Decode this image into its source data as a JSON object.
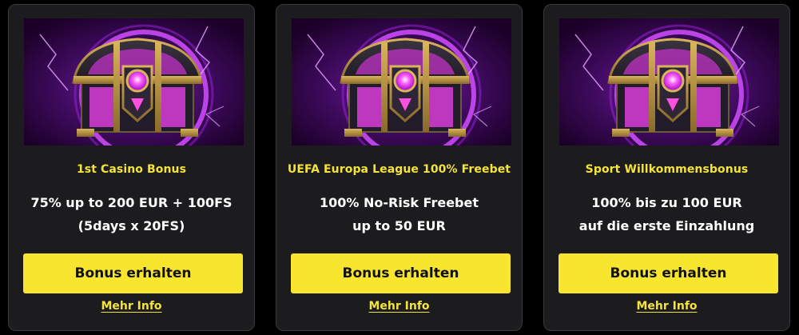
{
  "colors": {
    "page_background": "#000000",
    "card_background": "#1c1c1e",
    "accent_yellow": "#f4e43a",
    "button_yellow": "#f7e52e",
    "art_glow": "#c040ff"
  },
  "cards": [
    {
      "title": "1st Casino Bonus",
      "description_lines": [
        "75% up to 200 EUR + 100FS",
        "(5days x 20FS)"
      ],
      "image_icon": "treasure-chest-icon",
      "button_label": "Bonus erhalten",
      "info_label": "Mehr Info"
    },
    {
      "title": "UEFA Europa League 100% Freebet",
      "description_lines": [
        "100% No-Risk Freebet",
        "up to 50 EUR"
      ],
      "image_icon": "treasure-chest-icon",
      "button_label": "Bonus erhalten",
      "info_label": "Mehr Info"
    },
    {
      "title": "Sport Willkommensbonus",
      "description_lines": [
        "100% bis zu 100 EUR",
        "auf die erste Einzahlung"
      ],
      "image_icon": "treasure-chest-icon",
      "button_label": "Bonus erhalten",
      "info_label": "Mehr Info"
    }
  ]
}
